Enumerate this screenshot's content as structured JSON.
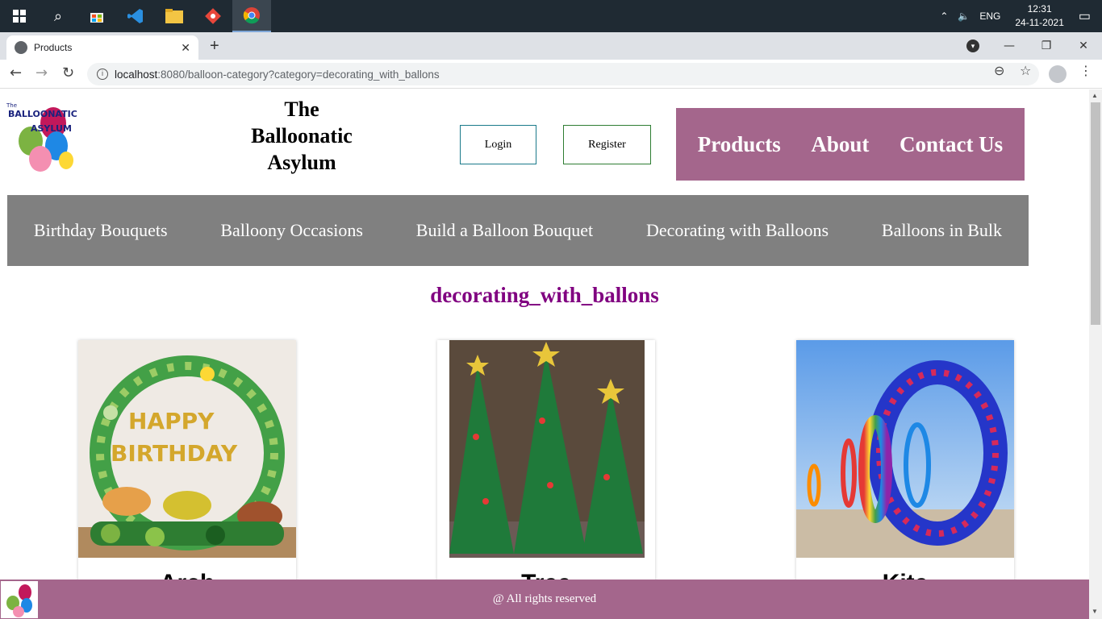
{
  "browser": {
    "tab_title": "Products",
    "url_host": "localhost",
    "url_rest": ":8080/balloon-category?category=decorating_with_ballons"
  },
  "taskbar": {
    "language": "ENG",
    "time": "12:31",
    "date": "24-11-2021"
  },
  "header": {
    "title_line1": "The",
    "title_line2": "Balloonatic",
    "title_line3": "Asylum",
    "login": "Login",
    "register": "Register",
    "logo_text": "The BALLOONATIC ASYLUM"
  },
  "main_nav": [
    "Products",
    "About",
    "Contact Us"
  ],
  "category_nav": [
    "Birthday Bouquets",
    "Balloony Occasions",
    "Build a Balloon Bouquet",
    "Decorating with Balloons",
    "Balloons in Bulk"
  ],
  "category_heading": "decorating_with_ballons",
  "products": [
    {
      "name": "Arch"
    },
    {
      "name": "Tree"
    },
    {
      "name": "Kite"
    }
  ],
  "footer": {
    "text": "@ All rights reserved"
  },
  "colors": {
    "accent": "#a4668c",
    "category_bar": "#808080",
    "heading": "#800080"
  }
}
